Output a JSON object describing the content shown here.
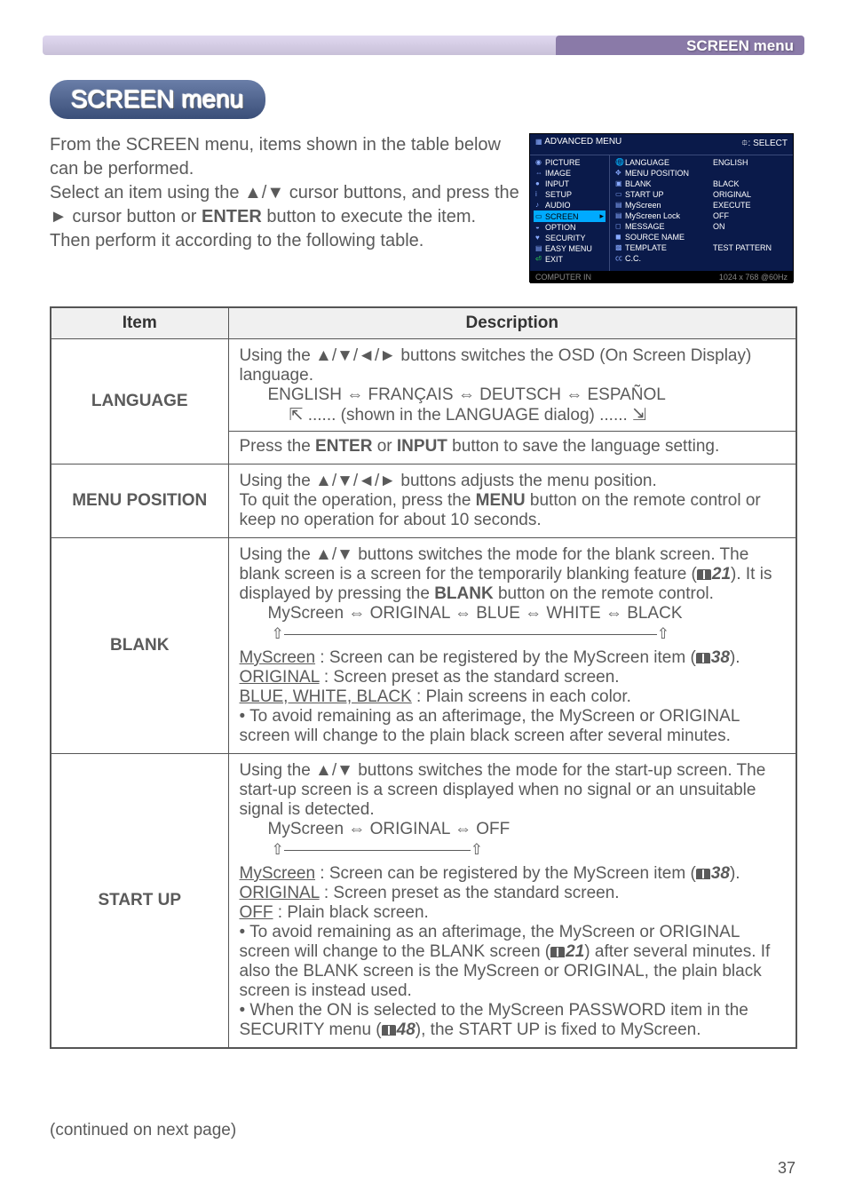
{
  "header": {
    "breadcrumb": "SCREEN menu",
    "title": "SCREEN menu"
  },
  "intro": {
    "line1": "From the SCREEN menu, items shown in the table below can be performed.",
    "line2a": "Select an item using the ▲/▼ cursor buttons, and press the ► cursor button or ",
    "line2b": "ENTER",
    "line2c": " button to execute the item. Then perform it according to the following table."
  },
  "osd": {
    "header_left": "ADVANCED MENU",
    "header_right": "⯐: SELECT",
    "left": {
      "picture": "PICTURE",
      "image": "IMAGE",
      "input": "INPUT",
      "setup": "SETUP",
      "audio": "AUDIO",
      "screen": "SCREEN",
      "option": "OPTION",
      "security": "SECURITY",
      "easy_menu": "EASY MENU",
      "exit": "EXIT"
    },
    "mid": {
      "language": "LANGUAGE",
      "menu_position": "MENU POSITION",
      "blank": "BLANK",
      "start_up": "START UP",
      "myscreen": "MyScreen",
      "myscreen_lock": "MyScreen Lock",
      "message": "MESSAGE",
      "source_name": "SOURCE NAME",
      "template": "TEMPLATE",
      "cc": "C.C."
    },
    "right": {
      "language_val": "ENGLISH",
      "blank_val": "BLACK",
      "start_up_val": "ORIGINAL",
      "myscreen_val": "EXECUTE",
      "myscreen_lock_val": "OFF",
      "message_val": "ON",
      "template_val": "TEST PATTERN"
    },
    "footer_left": "COMPUTER IN",
    "footer_right": "1024 x 768 @60Hz"
  },
  "table": {
    "head_item": "Item",
    "head_desc": "Description",
    "language": {
      "label": "LANGUAGE",
      "p1": "Using the ▲/▼/◄/► buttons switches the OSD (On Screen Display) language.",
      "opts": "ENGLISH ⇔ FRANÇAIS ⇔ DEUTSCH ⇔  ESPAÑOL",
      "cycle": "⇱ ...... (shown in the LANGUAGE dialog) ...... ⇲",
      "p2a": "Press the ",
      "p2b": "ENTER",
      "p2c": " or ",
      "p2d": "INPUT",
      "p2e": " button to save the language setting."
    },
    "menu_position": {
      "label": "MENU POSITION",
      "p1a": "Using the ▲/▼/◄/► buttons adjusts the menu position.",
      "p1b": "To quit the operation, press the ",
      "p1c": "MENU",
      "p1d": " button on the remote control or keep no operation for about 10 seconds."
    },
    "blank": {
      "label": "BLANK",
      "p1a": "Using the ▲/▼ buttons switches the mode for the blank screen. The blank screen is a screen for the temporarily blanking feature (",
      "ref1": "21",
      "p1b": "). It is displayed by pressing the ",
      "p1c": "BLANK",
      "p1d": " button on the remote control.",
      "opts": "MyScreen ⇔ ORIGINAL ⇔ BLUE ⇔ WHITE ⇔ BLACK",
      "ms_a": "MyScreen",
      "ms_b": " : Screen can be registered by the MyScreen item (",
      "ref2": "38",
      "ms_c": ").",
      "orig_a": "ORIGINAL",
      "orig_b": " : Screen preset as the standard screen.",
      "bwc_a": "BLUE, WHITE, BLACK",
      "bwc_b": " : Plain screens in each color.",
      "note": "• To avoid remaining as an afterimage, the MyScreen or ORIGINAL screen will change to the plain black screen after several minutes."
    },
    "start_up": {
      "label": "START UP",
      "p1": "Using the ▲/▼ buttons switches the mode for the start-up screen. The start-up screen is a screen displayed when no signal or an unsuitable signal is detected.",
      "opts": "MyScreen ⇔ ORIGINAL ⇔ OFF",
      "ms_a": "MyScreen",
      "ms_b": " : Screen can be registered by the MyScreen item (",
      "ref1": "38",
      "ms_c": ").",
      "orig_a": "ORIGINAL",
      "orig_b": " : Screen preset as the standard screen.",
      "off_a": "OFF",
      "off_b": " : Plain black screen.",
      "note1a": "• To avoid remaining as an afterimage, the MyScreen or ORIGINAL screen will change to the BLANK screen (",
      "ref2": "21",
      "note1b": ") after several minutes. If also the BLANK screen is the MyScreen or ORIGINAL, the plain black screen is instead used.",
      "note2a": "• When the ON is selected to the MyScreen PASSWORD item in the SECURITY menu (",
      "ref3": "48",
      "note2b": "), the START UP is fixed to MyScreen."
    }
  },
  "footer": {
    "continued": "(continued on next page)",
    "page": "37"
  }
}
